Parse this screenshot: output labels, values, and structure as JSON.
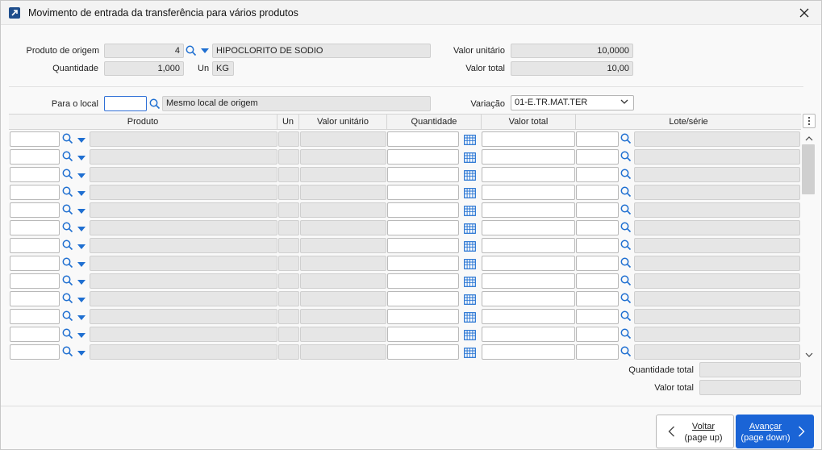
{
  "window": {
    "title": "Movimento de entrada da transferência para vários produtos"
  },
  "origin": {
    "produto_label": "Produto de origem",
    "produto_code": "4",
    "produto_name": "HIPOCLORITO DE SODIO",
    "quantidade_label": "Quantidade",
    "quantidade_value": "1,000",
    "un_label": "Un",
    "un_value": "KG",
    "valor_unitario_label": "Valor unitário",
    "valor_unitario_value": "10,0000",
    "valor_total_label": "Valor total",
    "valor_total_value": "10,00"
  },
  "destination": {
    "local_label": "Para o local",
    "local_value": "",
    "local_description": "Mesmo local de origem",
    "variacao_label": "Variação",
    "variacao_value": "01-E.TR.MAT.TER"
  },
  "grid": {
    "columns": [
      "Produto",
      "Un",
      "Valor unitário",
      "Quantidade",
      "Valor total",
      "Lote/série"
    ],
    "row_count": 13
  },
  "totals": {
    "quantidade_total_label": "Quantidade total",
    "quantidade_total_value": "",
    "valor_total_label": "Valor total",
    "valor_total_value": ""
  },
  "buttons": {
    "back_label": "Voltar",
    "back_hint": "(page up)",
    "next_label": "Avançar",
    "next_hint": "(page down)"
  },
  "colors": {
    "accent": "#1a64d6",
    "icon_blue": "#1f6fd1",
    "field_grey": "#e6e6e6"
  }
}
